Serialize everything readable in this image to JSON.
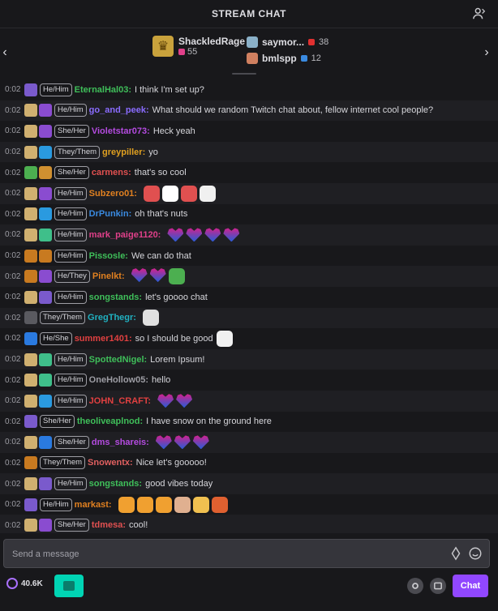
{
  "header": {
    "title": "STREAM CHAT"
  },
  "leaderboard": {
    "first": {
      "name": "ShackledRage",
      "score": "55"
    },
    "others": [
      {
        "name": "saymor...",
        "score": "38"
      },
      {
        "name": "bmlspp",
        "score": "12"
      }
    ]
  },
  "messages": [
    {
      "time": "0:02",
      "pronoun": "He/Him",
      "name": "EternalHal03",
      "name_color": "#3fbf5a",
      "text": "I think I'm set up?"
    },
    {
      "time": "0:02",
      "pronoun": "He/Him",
      "name": "go_and_peek",
      "name_color": "#8a6cff",
      "text": "What should we random Twitch chat about, fellow internet cool people?"
    },
    {
      "time": "0:02",
      "pronoun": "She/Her",
      "name": "Violetstar073",
      "name_color": "#b44be0",
      "text": "Heck yeah"
    },
    {
      "time": "0:02",
      "pronoun": "They/Them",
      "name": "greypiller",
      "name_color": "#e0a020",
      "text": "yo"
    },
    {
      "time": "0:02",
      "pronoun": "She/Her",
      "name": "carmens",
      "name_color": "#e05050",
      "text": "that's so cool"
    },
    {
      "time": "0:02",
      "pronoun": "He/Him",
      "name": "Subzero01",
      "name_color": "#e08020",
      "text": ""
    },
    {
      "time": "0:02",
      "pronoun": "He/Him",
      "name": "DrPunkin",
      "name_color": "#3a8ae0",
      "text": "oh that's nuts"
    },
    {
      "time": "0:02",
      "pronoun": "He/Him",
      "name": "mark_paige1120",
      "name_color": "#e0408a",
      "text": ""
    },
    {
      "time": "0:02",
      "pronoun": "He/Him",
      "name": "Pissosle",
      "name_color": "#3fbf5a",
      "text": "We can do that"
    },
    {
      "time": "0:02",
      "pronoun": "He/They",
      "name": "Pinelkt",
      "name_color": "#e08020",
      "text": ""
    },
    {
      "time": "0:02",
      "pronoun": "He/Him",
      "name": "songstands",
      "name_color": "#3fbf5a",
      "text": "let's goooo chat"
    },
    {
      "time": "0:02",
      "pronoun": "They/Them",
      "name": "GregThegr",
      "name_color": "#20b0c0",
      "text": ""
    },
    {
      "time": "0:02",
      "pronoun": "He/She",
      "name": "summer1401",
      "name_color": "#e04040",
      "text": "so I should be good"
    },
    {
      "time": "0:02",
      "pronoun": "He/Him",
      "name": "SpottedNigel",
      "name_color": "#3fbf5a",
      "text": "Lorem Ipsum!"
    },
    {
      "time": "0:02",
      "pronoun": "He/Him",
      "name": "OneHollow05",
      "name_color": "#9d9da4",
      "text": "hello"
    },
    {
      "time": "0:02",
      "pronoun": "He/Him",
      "name": "JOHN_CRAFT",
      "name_color": "#e04040",
      "text": ""
    },
    {
      "time": "0:02",
      "pronoun": "She/Her",
      "name": "theoliveaplnod",
      "name_color": "#3fbf5a",
      "text": "I have snow on the ground here"
    },
    {
      "time": "0:02",
      "pronoun": "She/Her",
      "name": "dms_shareis",
      "name_color": "#b44be0",
      "text": ""
    },
    {
      "time": "0:02",
      "pronoun": "They/Them",
      "name": "Snowentx",
      "name_color": "#e06060",
      "text": "Nice let's gooooo!"
    },
    {
      "time": "0:02",
      "pronoun": "He/Him",
      "name": "songstands",
      "name_color": "#3fbf5a",
      "text": "good vibes today"
    },
    {
      "time": "0:02",
      "pronoun": "He/Him",
      "name": "markast",
      "name_color": "#e08020",
      "text": ""
    },
    {
      "time": "0:02",
      "pronoun": "She/Her",
      "name": "tdmesa",
      "name_color": "#e05050",
      "text": "cool!"
    }
  ],
  "input": {
    "placeholder": "Send a message"
  },
  "bottom": {
    "points": "40.6K",
    "chat_button": "Chat"
  },
  "colors": {
    "accent": "#9147ff",
    "bonus": "#00d4b4",
    "background": "#18181b"
  }
}
